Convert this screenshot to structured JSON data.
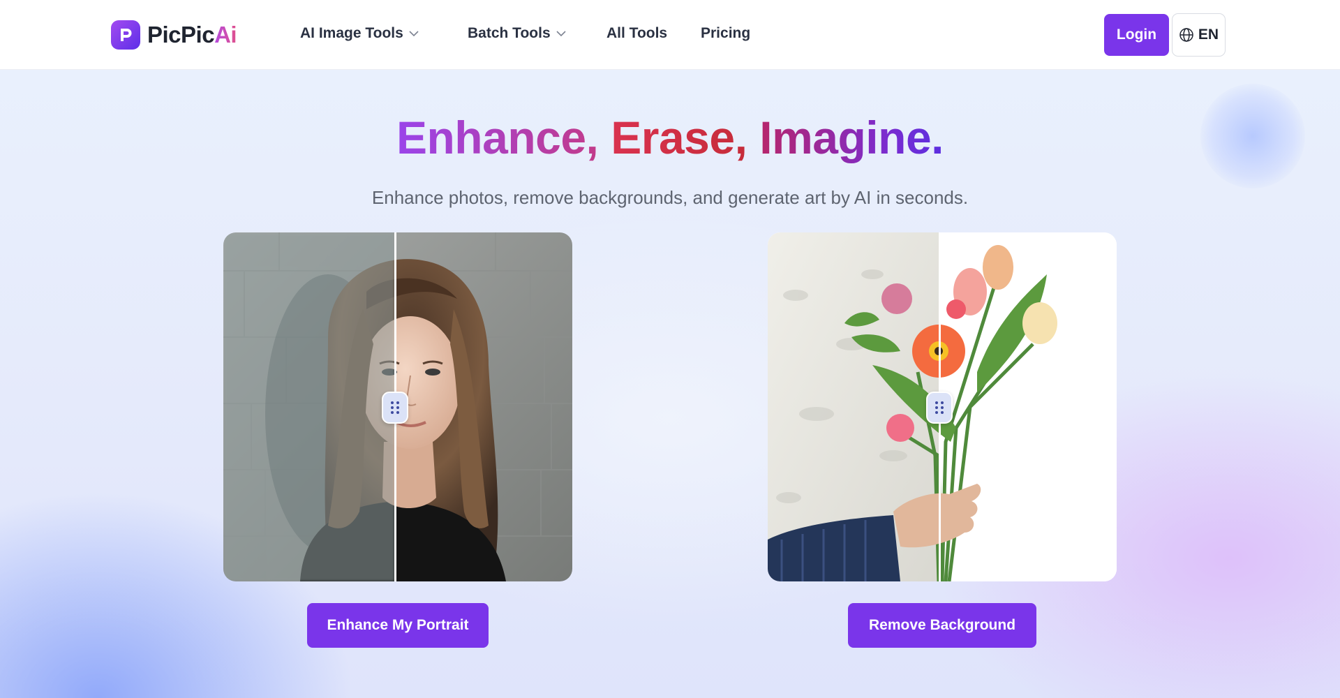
{
  "brand": {
    "name_main": "PicPic",
    "name_accent": "Ai",
    "logo_icon": "p-logo-icon",
    "accent_color": "#7a35ea"
  },
  "nav": {
    "items": [
      {
        "label": "AI Image Tools",
        "has_dropdown": true
      },
      {
        "label": "Batch Tools",
        "has_dropdown": true
      },
      {
        "label": "All Tools",
        "has_dropdown": false
      },
      {
        "label": "Pricing",
        "has_dropdown": false
      }
    ],
    "login_label": "Login",
    "language_label": "EN",
    "language_icon": "globe-icon"
  },
  "hero": {
    "headline_part1": "Enhance,",
    "headline_part2": "Erase,",
    "headline_part3": "Imagine.",
    "subtitle": "Enhance photos, remove backgrounds, and generate art by AI in seconds."
  },
  "comparisons": [
    {
      "cta_label": "Enhance My Portrait",
      "handle_icon": "drag-handle-icon"
    },
    {
      "cta_label": "Remove Background",
      "handle_icon": "drag-handle-icon"
    }
  ]
}
